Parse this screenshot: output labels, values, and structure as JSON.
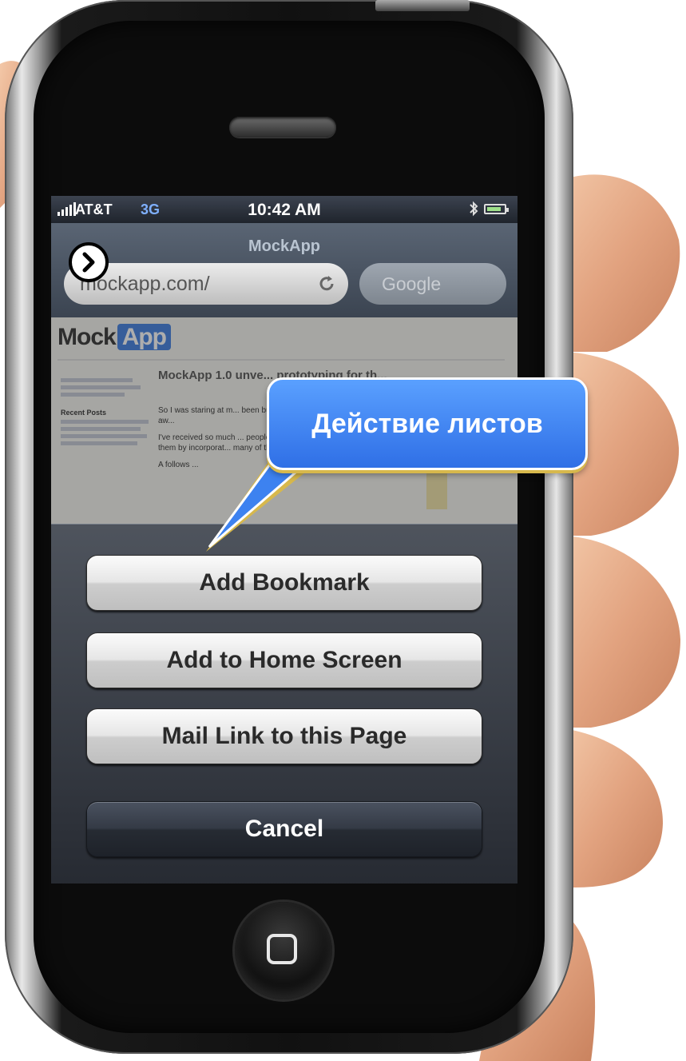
{
  "status_bar": {
    "carrier": "AT&T",
    "network": "3G",
    "time": "10:42 AM",
    "bluetooth_icon": "bluetooth-icon",
    "battery_icon": "battery-icon"
  },
  "navbar": {
    "title": "MockApp",
    "url_value": "mockapp.com/",
    "search_placeholder": "Google",
    "reload_icon": "reload-icon"
  },
  "webpage": {
    "logo_text": "Mock",
    "logo_badge": "App",
    "article_heading": "MockApp 1.0 unve... prototyping for th...",
    "paragraphs": [
      "So I was staring at m... been bugging about ... clearly got carried aw...",
      "I've received so much ... people who love Mo... it on a daily basis ... them by incorporat... many of their ideas as possible into ...",
      "A follows ..."
    ],
    "sidebar_title": "Recent Posts"
  },
  "action_sheet": {
    "buttons": [
      {
        "label": "Add Bookmark"
      },
      {
        "label": "Add to Home Screen"
      },
      {
        "label": "Mail Link to this Page"
      }
    ],
    "cancel_label": "Cancel"
  },
  "annotation": {
    "callout_text": "Действие листов",
    "nav_arrow_icon": "chevron-right-icon"
  },
  "colors": {
    "callout_blue": "#3d82f0",
    "sheet_dark": "#2a2f38",
    "button_light": "#e6e6e6"
  }
}
